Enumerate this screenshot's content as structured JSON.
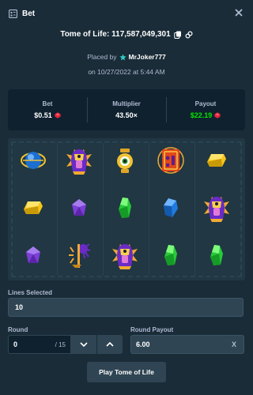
{
  "header": {
    "title": "Bet",
    "close_icon": "close-icon",
    "bet_icon": "receipt-icon"
  },
  "game": {
    "name_and_id": "Tome of Life: 117,587,049,301",
    "copy_icon": "copy-icon",
    "link_icon": "link-icon"
  },
  "placed": {
    "prefix": "Placed by",
    "user": "MrJoker777",
    "user_icon": "star-badge-icon"
  },
  "date": "on 10/27/2022 at 5:44 AM",
  "stats": {
    "bet": {
      "label": "Bet",
      "value": "$0.51"
    },
    "multiplier": {
      "label": "Multiplier",
      "value": "43.50×"
    },
    "payout": {
      "label": "Payout",
      "value": "$22.19"
    },
    "currency_icon": "ruby-coin-icon"
  },
  "reels": {
    "columns": [
      [
        "blue-scarab",
        "yellow-gem",
        "purple-gem"
      ],
      [
        "pharaoh",
        "purple-gem",
        "spider-scepter"
      ],
      [
        "eye-amulet",
        "green-gem",
        "pharaoh"
      ],
      [
        "tome-book",
        "blue-gem",
        "green-gem"
      ],
      [
        "yellow-gem",
        "pharaoh",
        "green-gem"
      ]
    ]
  },
  "lines": {
    "label": "Lines Selected",
    "value": "10"
  },
  "round": {
    "label": "Round",
    "value": "0",
    "max": "/ 15"
  },
  "round_payout": {
    "label": "Round Payout",
    "value": "6.00",
    "suffix": "X"
  },
  "play_button": "Play Tome of Life",
  "colors": {
    "bg": "#1a2c38",
    "panel": "#0f212e",
    "green": "#00e701",
    "field": "#2f4553"
  }
}
